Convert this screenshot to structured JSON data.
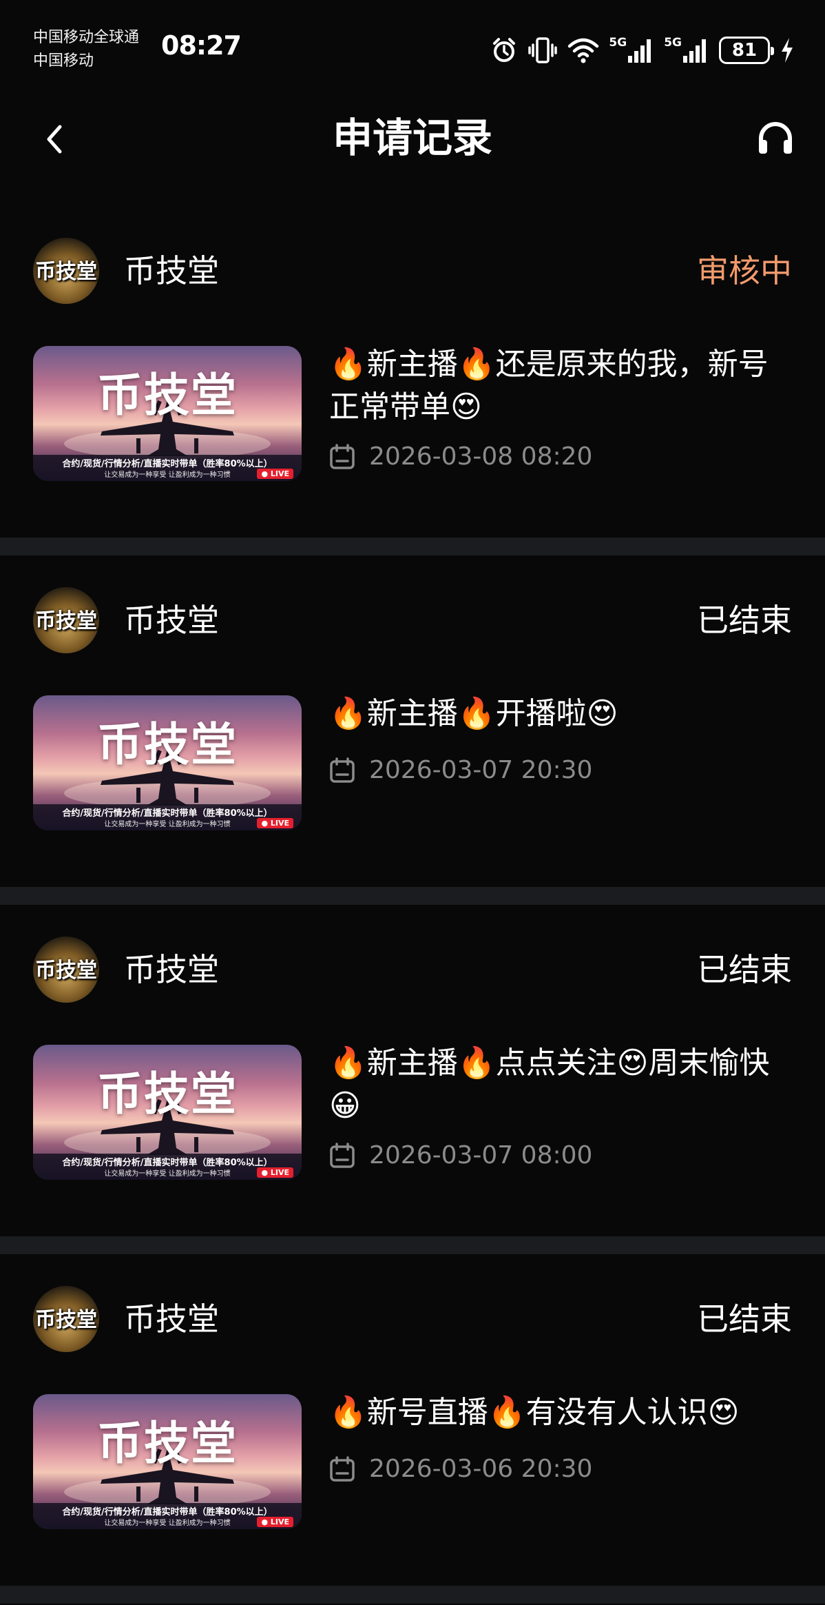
{
  "status_bar": {
    "carrier_1": "中国移动全球通",
    "carrier_2": "中国移动",
    "time": "08:27",
    "network_1": "5G",
    "network_2": "5G",
    "battery": "81",
    "icons": [
      "alarm-icon",
      "vibrate-icon",
      "wifi-icon",
      "signal-icon",
      "signal-icon",
      "battery-icon",
      "charging-icon"
    ]
  },
  "nav": {
    "title": "申请记录",
    "back_icon": "chevron-left-icon",
    "service_icon": "headset-icon"
  },
  "colors": {
    "background": "#080808",
    "divider": "#1b1c1f",
    "status_pending": "#f29b6c",
    "status_ended": "#ffffff",
    "time_text": "#8b8b8b"
  },
  "records": [
    {
      "channel": "币技堂",
      "status": "审核中",
      "status_type": "pending",
      "thumb_title": "币技堂",
      "thumb_sub1": "合约/现货/行情分析/直播实时带单（胜率80%以上）",
      "thumb_sub2": "让交易成为一种享受  让盈利成为一种习惯",
      "thumb_live": "● LIVE",
      "title": "🔥新主播🔥还是原来的我，新号正常带单😍",
      "time": "2026-03-08 08:20"
    },
    {
      "channel": "币技堂",
      "status": "已结束",
      "status_type": "ended",
      "thumb_title": "币技堂",
      "thumb_sub1": "合约/现货/行情分析/直播实时带单（胜率80%以上）",
      "thumb_sub2": "让交易成为一种享受  让盈利成为一种习惯",
      "thumb_live": "● LIVE",
      "title": "🔥新主播🔥开播啦😍",
      "time": "2026-03-07 20:30"
    },
    {
      "channel": "币技堂",
      "status": "已结束",
      "status_type": "ended",
      "thumb_title": "币技堂",
      "thumb_sub1": "合约/现货/行情分析/直播实时带单（胜率80%以上）",
      "thumb_sub2": "让交易成为一种享受  让盈利成为一种习惯",
      "thumb_live": "● LIVE",
      "title": "🔥新主播🔥点点关注😍周末愉快😀",
      "time": "2026-03-07 08:00"
    },
    {
      "channel": "币技堂",
      "status": "已结束",
      "status_type": "ended",
      "thumb_title": "币技堂",
      "thumb_sub1": "合约/现货/行情分析/直播实时带单（胜率80%以上）",
      "thumb_sub2": "让交易成为一种享受  让盈利成为一种习惯",
      "thumb_live": "● LIVE",
      "title": "🔥新号直播🔥有没有人认识😍",
      "time": "2026-03-06 20:30"
    }
  ]
}
